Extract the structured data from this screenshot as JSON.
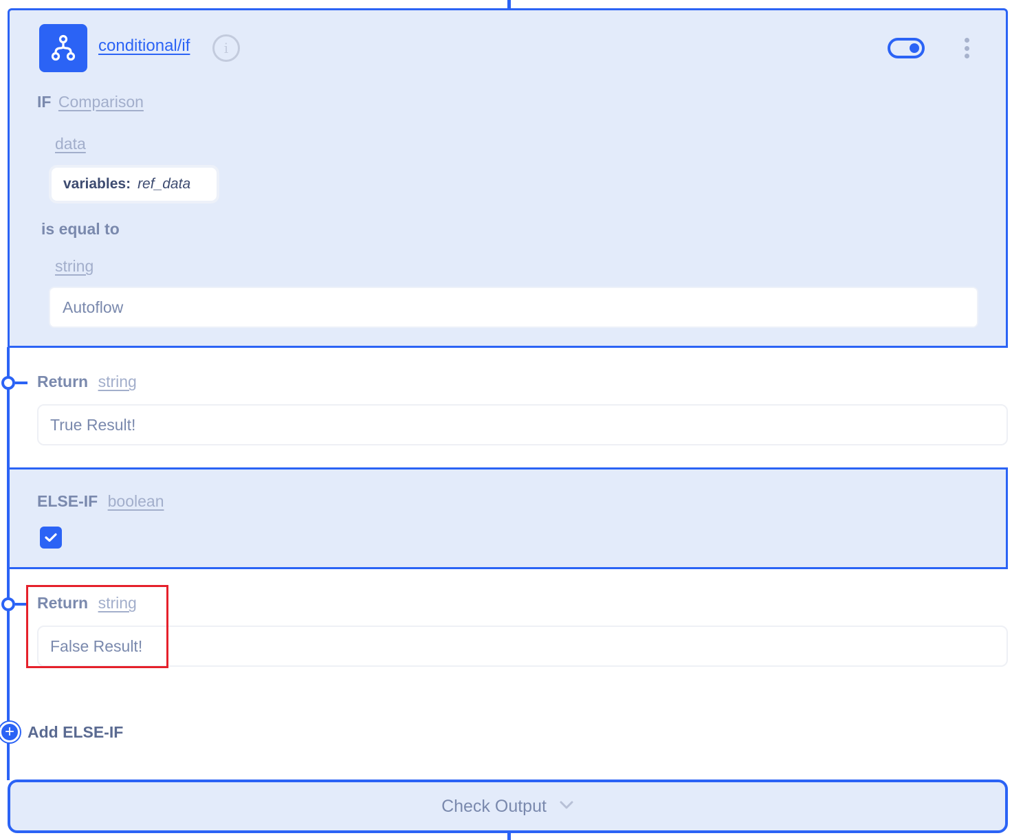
{
  "node": {
    "title": "conditional/if",
    "icon": "branch-icon",
    "enabled": true
  },
  "if_section": {
    "keyword": "IF",
    "type_link": "Comparison",
    "left_operand": {
      "type_link": "data",
      "key": "variables:",
      "value": "ref_data"
    },
    "operator": "is equal to",
    "right_operand": {
      "type_link": "string",
      "value": "Autoflow"
    }
  },
  "true_branch": {
    "keyword": "Return",
    "type_link": "string",
    "value": "True Result!"
  },
  "elseif_section": {
    "keyword": "ELSE-IF",
    "type_link": "boolean",
    "checked": true
  },
  "false_branch": {
    "keyword": "Return",
    "type_link": "string",
    "value": "False Result!"
  },
  "add_elseif": {
    "label": "Add ELSE-IF",
    "icon": "plus"
  },
  "check_output": {
    "label": "Check Output"
  },
  "colors": {
    "accent": "#2b63f5",
    "panel_bg": "#e3ebfa",
    "label": "#7a89ad",
    "link": "#a2aecb",
    "highlight": "#e5202b"
  }
}
